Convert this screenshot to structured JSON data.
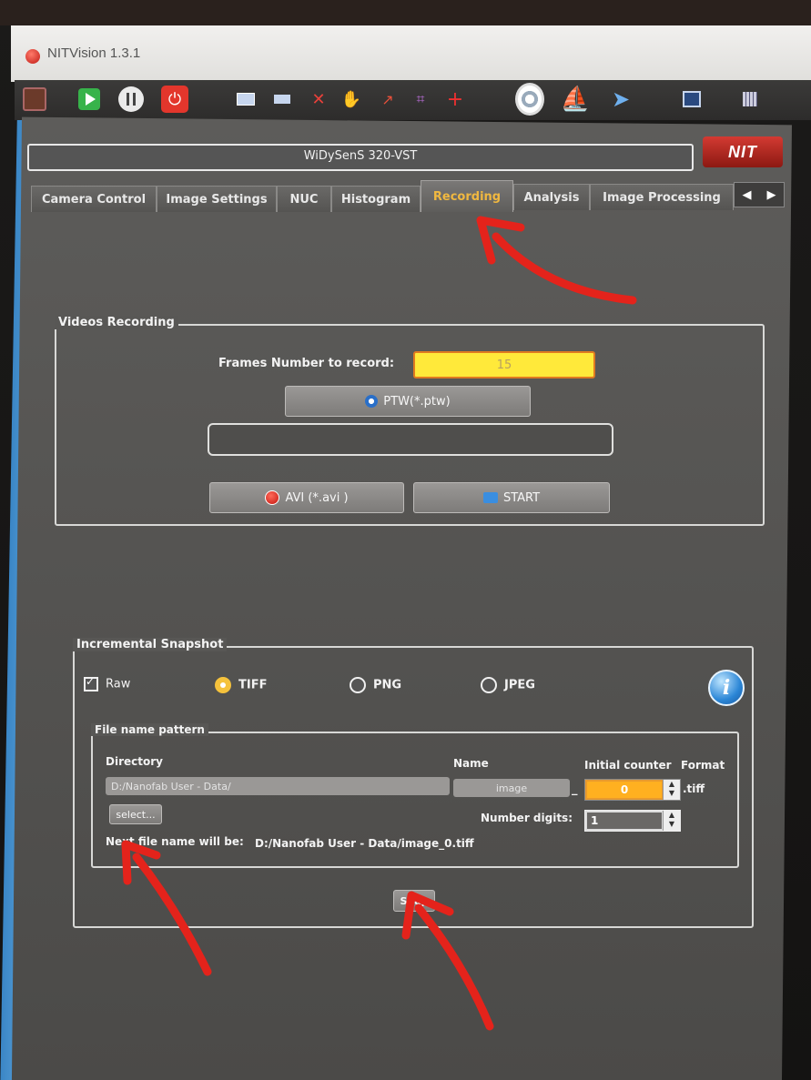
{
  "app": {
    "title": "NITVision 1.3.1"
  },
  "toolbar": {
    "icons": [
      "camera-icon",
      "play-icon",
      "pause-icon",
      "power-icon",
      "message-icon",
      "menu-icon",
      "cross-red-icon",
      "hand-icon",
      "line-tool-icon",
      "crop-icon",
      "crosshair-plus-icon",
      "target-icon",
      "ship-icon",
      "plane-icon",
      "window-icon",
      "grid-icon"
    ]
  },
  "camera": {
    "name": "WiDySenS 320-VST",
    "logo_text": "NIT"
  },
  "tabs": [
    {
      "label": "Camera Control",
      "active": false
    },
    {
      "label": "Image Settings",
      "active": false
    },
    {
      "label": "NUC",
      "active": false
    },
    {
      "label": "Histogram",
      "active": false
    },
    {
      "label": "Recording",
      "active": true
    },
    {
      "label": "Analysis",
      "active": false
    },
    {
      "label": "Image Processing",
      "active": false
    }
  ],
  "tab_scroll": {
    "left": "◀",
    "right": "▶"
  },
  "videos_recording": {
    "title": "Videos Recording",
    "frames_label": "Frames Number to record:",
    "frames_value": "15",
    "ptw_button": "PTW(*.ptw)",
    "path_value": "",
    "avi_button": "AVI (*.avi )",
    "start_button": "START"
  },
  "incremental_snapshot": {
    "title": "Incremental Snapshot",
    "raw_label": "Raw",
    "raw_checked": true,
    "formats": [
      {
        "label": "TIFF",
        "selected": true
      },
      {
        "label": "PNG",
        "selected": false
      },
      {
        "label": "JPEG",
        "selected": false
      }
    ],
    "info_glyph": "i",
    "file_name_pattern": {
      "title": "File name pattern",
      "directory_header": "Directory",
      "name_header": "Name",
      "initial_counter_header": "Initial counter",
      "format_header": "Format",
      "directory_value": "D:/Nanofab User - Data/",
      "name_value": "image",
      "separator": "_",
      "initial_counter_value": "0",
      "format_value": ".tiff",
      "select_button": "select...",
      "number_digits_label": "Number digits:",
      "number_digits_value": "1",
      "next_file_label": "Next file name will be:",
      "next_file_value": "D:/Nanofab User - Data/image_0.tiff"
    },
    "snap_button": "Snap"
  },
  "colors": {
    "accent_tab": "#f0b840",
    "frames_input": "#ffe93a",
    "arrow": "#e4231b"
  }
}
